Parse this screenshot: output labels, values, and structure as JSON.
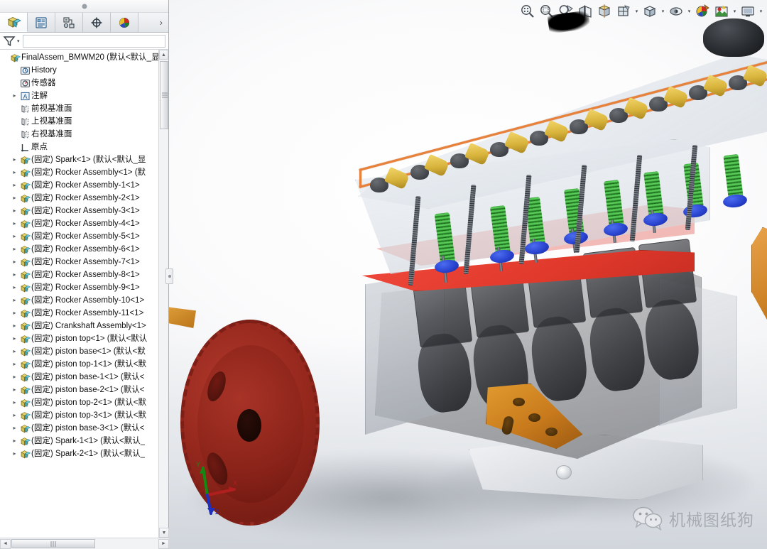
{
  "window": {
    "title": "FinalAssem_BMWM20",
    "collapse_handle": "panel-collapse-handle"
  },
  "tabs": [
    {
      "name": "feature-manager-design-tree",
      "icon": "assembly-cube-icon",
      "active": true
    },
    {
      "name": "property-manager",
      "icon": "property-list-icon",
      "active": false
    },
    {
      "name": "configuration-manager",
      "icon": "configuration-icon",
      "active": false
    },
    {
      "name": "dimxpert-manager",
      "icon": "crosshair-icon",
      "active": false
    },
    {
      "name": "display-manager",
      "icon": "appearance-sphere-icon",
      "active": false
    }
  ],
  "tabs_more": "›",
  "filter": {
    "icon": "filter-funnel-icon",
    "caret": "▾",
    "placeholder": ""
  },
  "tree": [
    {
      "label": "FinalAssem_BMWM20  (默认<默认_显",
      "icon": "assembly-icon",
      "indent": 0,
      "twist": "",
      "root": true
    },
    {
      "label": "History",
      "icon": "history-icon",
      "indent": 1,
      "twist": ""
    },
    {
      "label": "传感器",
      "icon": "sensors-icon",
      "indent": 1,
      "twist": ""
    },
    {
      "label": "注解",
      "icon": "annotations-icon",
      "indent": 1,
      "twist": "▸"
    },
    {
      "label": "前视基准面",
      "icon": "plane-icon",
      "indent": 1,
      "twist": ""
    },
    {
      "label": "上视基准面",
      "icon": "plane-icon",
      "indent": 1,
      "twist": ""
    },
    {
      "label": "右视基准面",
      "icon": "plane-icon",
      "indent": 1,
      "twist": ""
    },
    {
      "label": "原点",
      "icon": "origin-icon",
      "indent": 1,
      "twist": ""
    },
    {
      "label": "(固定) Spark<1> (默认<默认_显",
      "icon": "part-icon",
      "indent": 1,
      "twist": "▸"
    },
    {
      "label": "(固定) Rocker Assembly<1> (默",
      "icon": "part-icon",
      "indent": 1,
      "twist": "▸"
    },
    {
      "label": "(固定) Rocker Assembly-1<1>",
      "icon": "part-icon",
      "indent": 1,
      "twist": "▸"
    },
    {
      "label": "(固定) Rocker Assembly-2<1>",
      "icon": "part-icon",
      "indent": 1,
      "twist": "▸"
    },
    {
      "label": "(固定) Rocker Assembly-3<1>",
      "icon": "part-icon",
      "indent": 1,
      "twist": "▸"
    },
    {
      "label": "(固定) Rocker Assembly-4<1>",
      "icon": "part-icon",
      "indent": 1,
      "twist": "▸"
    },
    {
      "label": "(固定) Rocker Assembly-5<1>",
      "icon": "part-icon",
      "indent": 1,
      "twist": "▸"
    },
    {
      "label": "(固定) Rocker Assembly-6<1>",
      "icon": "part-icon",
      "indent": 1,
      "twist": "▸"
    },
    {
      "label": "(固定) Rocker Assembly-7<1>",
      "icon": "part-icon",
      "indent": 1,
      "twist": "▸"
    },
    {
      "label": "(固定) Rocker Assembly-8<1>",
      "icon": "part-icon",
      "indent": 1,
      "twist": "▸"
    },
    {
      "label": "(固定) Rocker Assembly-9<1>",
      "icon": "part-icon",
      "indent": 1,
      "twist": "▸"
    },
    {
      "label": "(固定) Rocker Assembly-10<1>",
      "icon": "part-icon",
      "indent": 1,
      "twist": "▸"
    },
    {
      "label": "(固定) Rocker Assembly-11<1>",
      "icon": "part-icon",
      "indent": 1,
      "twist": "▸"
    },
    {
      "label": "(固定) Crankshaft Assembly<1>",
      "icon": "part-icon",
      "indent": 1,
      "twist": "▸"
    },
    {
      "label": "(固定) piston top<1> (默认<默认",
      "icon": "part-icon",
      "indent": 1,
      "twist": "▸"
    },
    {
      "label": "(固定) piston base<1> (默认<默",
      "icon": "part-icon",
      "indent": 1,
      "twist": "▸"
    },
    {
      "label": "(固定) piston top-1<1> (默认<默",
      "icon": "part-icon",
      "indent": 1,
      "twist": "▸"
    },
    {
      "label": "(固定) piston base-1<1> (默认<",
      "icon": "part-icon",
      "indent": 1,
      "twist": "▸"
    },
    {
      "label": "(固定) piston base-2<1> (默认<",
      "icon": "part-icon",
      "indent": 1,
      "twist": "▸"
    },
    {
      "label": "(固定) piston top-2<1> (默认<默",
      "icon": "part-icon",
      "indent": 1,
      "twist": "▸"
    },
    {
      "label": "(固定) piston top-3<1> (默认<默",
      "icon": "part-icon",
      "indent": 1,
      "twist": "▸"
    },
    {
      "label": "(固定) piston base-3<1> (默认<",
      "icon": "part-icon",
      "indent": 1,
      "twist": "▸"
    },
    {
      "label": "(固定) Spark-1<1> (默认<默认_",
      "icon": "part-icon",
      "indent": 1,
      "twist": "▸"
    },
    {
      "label": "(固定) Spark-2<1> (默认<默认_",
      "icon": "part-icon",
      "indent": 1,
      "twist": "▸"
    }
  ],
  "scroll": {
    "up_arrow": "▲",
    "down_arrow": "▼",
    "left_arrow": "◄",
    "right_arrow": "►"
  },
  "toolbar": [
    {
      "name": "zoom-to-fit-button",
      "icon": "magnifier-fit-icon",
      "caret": false
    },
    {
      "name": "zoom-to-area-button",
      "icon": "magnifier-area-icon",
      "caret": false
    },
    {
      "name": "zoom-in-out-button",
      "icon": "magnifier-dynamic-icon",
      "caret": false
    },
    {
      "name": "section-view-button",
      "icon": "section-view-icon",
      "caret": false
    },
    {
      "name": "view-orientation-button",
      "icon": "view-orientation-icon",
      "caret": false
    },
    {
      "name": "display-style-button",
      "icon": "display-style-icon",
      "caret": true
    },
    {
      "name": "view-settings-button",
      "icon": "cube-shaded-icon",
      "caret": true
    },
    {
      "name": "hide-show-items-button",
      "icon": "eye-glasses-icon",
      "caret": true
    },
    {
      "name": "edit-appearance-button",
      "icon": "appearance-sphere-icon",
      "caret": false
    },
    {
      "name": "apply-scene-button",
      "icon": "scene-icon",
      "caret": true
    },
    {
      "name": "view-settings-display-button",
      "icon": "monitor-icon",
      "caret": true
    }
  ],
  "viewport": {
    "model_name": "BMW M20 inline-six engine assembly",
    "triad": {
      "x_label": "X",
      "y_label": "Y",
      "z_label": "Z"
    },
    "colors": {
      "gasket_orange": "#e8813a",
      "deck_red": "#e13a2c",
      "rocker_yellow": "#d8b43c",
      "spring_green": "#3aa93a",
      "valve_blue": "#2a44d0",
      "flywheel_red": "#96281d",
      "bracket_orange": "#c87a1c",
      "pan_gray": "#dcdfe3",
      "pulley_black": "#2a2d31"
    }
  },
  "watermark": {
    "icon": "wechat-icon",
    "text": "机械图纸狗"
  }
}
